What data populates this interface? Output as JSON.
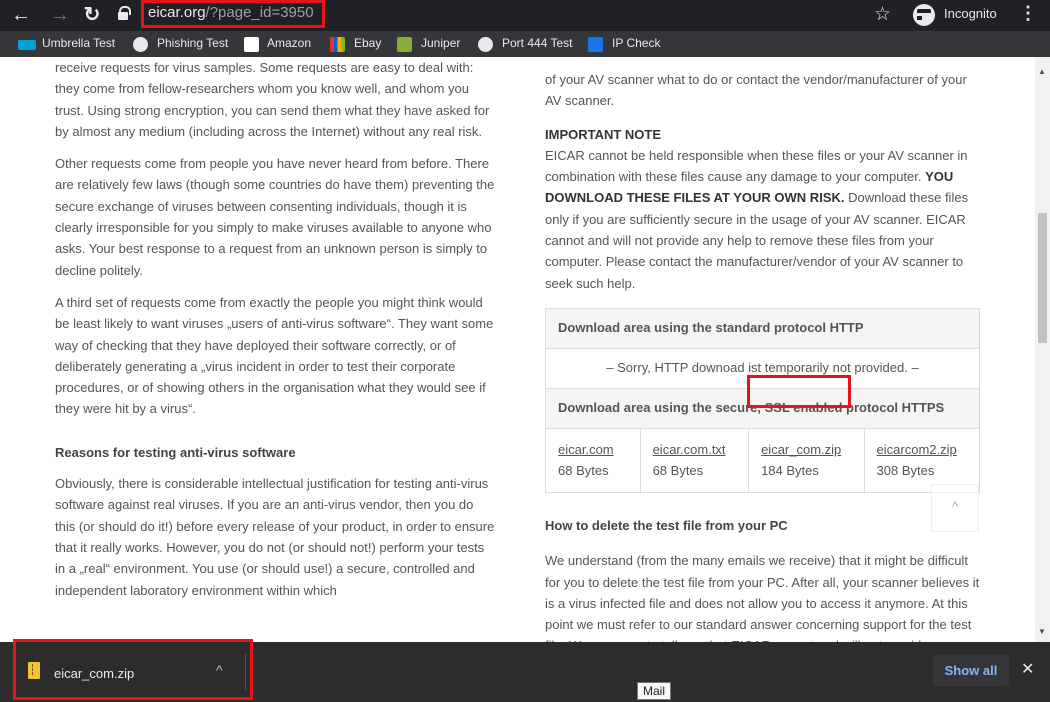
{
  "browser": {
    "url_domain": "eicar.org",
    "url_path": "/?page_id=3950",
    "back_icon": "←",
    "forward_icon": "→",
    "reload_icon": "↻",
    "star_icon": "☆",
    "incognito_label": "Incognito",
    "menu_icon": "⋮"
  },
  "bookmarks": [
    {
      "label": "Umbrella Test",
      "icon": "cisco-icon",
      "color": "#049fd9"
    },
    {
      "label": "Phishing Test",
      "icon": "globe-icon",
      "color": "#e8eaed"
    },
    {
      "label": "Amazon",
      "icon": "amazon-icon",
      "color": "#ffffff"
    },
    {
      "label": "Ebay",
      "icon": "ebay-icon",
      "color": "#e53238"
    },
    {
      "label": "Juniper",
      "icon": "juniper-icon",
      "color": "#84b135"
    },
    {
      "label": "Port 444 Test",
      "icon": "globe-icon",
      "color": "#e8eaed"
    },
    {
      "label": "IP Check",
      "icon": "ipcheck-icon",
      "color": "#1a73e8"
    }
  ],
  "left_column": {
    "p1": "receive requests for virus samples. Some requests are easy to deal with: they come from fellow-researchers whom you know well, and whom you trust. Using strong encryption, you can send them what they have asked for by almost any medium (including across the Internet) without any real risk.",
    "p2": "Other requests come from people you have never heard from before. There are relatively few laws (though some countries do have them) preventing the secure exchange of viruses between consenting individuals, though it is clearly irresponsible for you simply to make viruses available to anyone who asks. Your best response to a request from an unknown person is simply to decline politely.",
    "p3": "A third set of requests come from exactly the people you might think would be least likely to want viruses „users of anti-virus software“. They want some way of checking that they have deployed their software correctly, or of deliberately generating a „virus incident in order to test their corporate procedures, or of showing others in the organisation what they would see if they were hit by a virus“.",
    "heading": "Reasons for testing anti-virus software",
    "p4": "Obviously, there is considerable intellectual justification for testing anti-virus software against real viruses. If you are an anti-virus vendor, then you do this (or should do it!) before every release of your product, in order to ensure that it really works. However, you do not (or should not!) perform your tests in a „real“ environment. You use (or should use!) a secure, controlled and independent laboratory environment within which"
  },
  "right_column": {
    "intro": "of your AV scanner what to do or contact the vendor/manufacturer of your AV scanner.",
    "note_heading": "IMPORTANT NOTE",
    "note_a": "EICAR cannot be held responsible when these files or your AV scanner in combination with these files cause any damage to your computer.",
    "note_bold": "YOU DOWNLOAD THESE FILES AT YOUR OWN RISK.",
    "note_b": "Download these files only if you are sufficiently secure in the usage of your AV scanner. EICAR cannot and will not provide any help to remove these files from your computer. Please contact the manufacturer/vendor of your AV scanner to seek such help.",
    "http_heading": "Download area using the standard protocol HTTP",
    "http_sorry": "– Sorry, HTTP downoad ist temporarily not provided. –",
    "https_heading": "Download area using the secure, SSL enabled protocol HTTPS",
    "files": [
      {
        "name": "eicar.com",
        "size": "68 Bytes"
      },
      {
        "name": "eicar.com.txt",
        "size": "68 Bytes"
      },
      {
        "name": "eicar_com.zip",
        "size": "184 Bytes"
      },
      {
        "name": "eicarcom2.zip",
        "size": "308 Bytes"
      }
    ],
    "delete_heading": "How to delete the test file from your PC",
    "delete_text": "We understand (from the many emails we receive) that it might be difficult for you to delete the test file from your PC. After all, your scanner believes it is a virus infected file and does not allow you to access it anymore. At this point we must refer to our standard answer concerning support for the test file. We are sorry to tell you that EICAR cannot and will not provide"
  },
  "scroll_top_icon": "^",
  "download_bar": {
    "filename": "eicar_com.zip",
    "chevron": "^",
    "show_all": "Show all",
    "close": "✕"
  },
  "tooltip": "Mail",
  "colors": {
    "highlight": "#e3151a",
    "chrome": "#202124",
    "show_all": "#8ab4f8"
  }
}
